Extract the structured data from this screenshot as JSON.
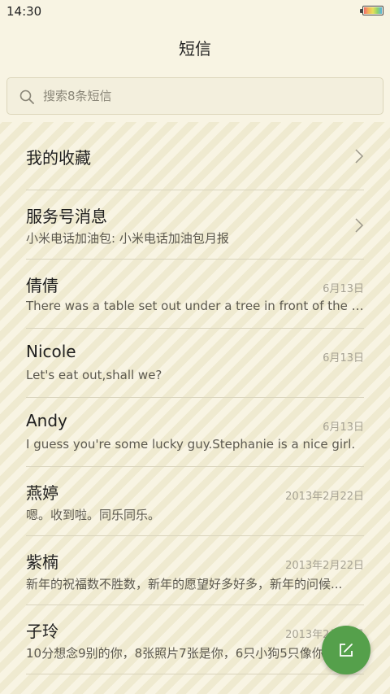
{
  "status_bar": {
    "time": "14:30",
    "battery_level": 1.0
  },
  "header": {
    "title": "短信"
  },
  "search": {
    "placeholder": "搜索8条短信",
    "value": ""
  },
  "list": {
    "favorites": {
      "title": "我的收藏"
    },
    "items": [
      {
        "name": "服务号消息",
        "preview": "小米电话加油包: 小米电话加油包月报",
        "date": "",
        "has_chevron": true
      },
      {
        "name": "倩倩",
        "preview": "There was a table set out under a tree in front of the ho..",
        "date": "6月13日",
        "has_chevron": false
      },
      {
        "name": "Nicole",
        "preview": "Let's eat out,shall we?",
        "date": "6月13日",
        "has_chevron": false
      },
      {
        "name": "Andy",
        "preview": "I guess you're some lucky guy.Stephanie is a nice girl.",
        "date": "6月13日",
        "has_chevron": false
      },
      {
        "name": "燕婷",
        "preview": "嗯。收到啦。同乐同乐。",
        "date": "2013年2月22日",
        "has_chevron": false
      },
      {
        "name": "紫楠",
        "preview": "新年的祝福数不胜数，新年的愿望好多好多，新年的问候...",
        "date": "2013年2月22日",
        "has_chevron": false
      },
      {
        "name": "子玲",
        "preview": "10分想念9别的你，8张照片7张是你，6只小狗5只像你",
        "date": "2013年2月22日",
        "has_chevron": false
      }
    ]
  },
  "icons": {
    "search": "search-icon",
    "chevron": "chevron-right-icon",
    "compose": "compose-icon",
    "battery": "battery-icon"
  },
  "colors": {
    "accent": "#55a04b",
    "background": "#f4f0dc",
    "secondary_text": "#5c594f",
    "date_text": "#a7a394"
  }
}
